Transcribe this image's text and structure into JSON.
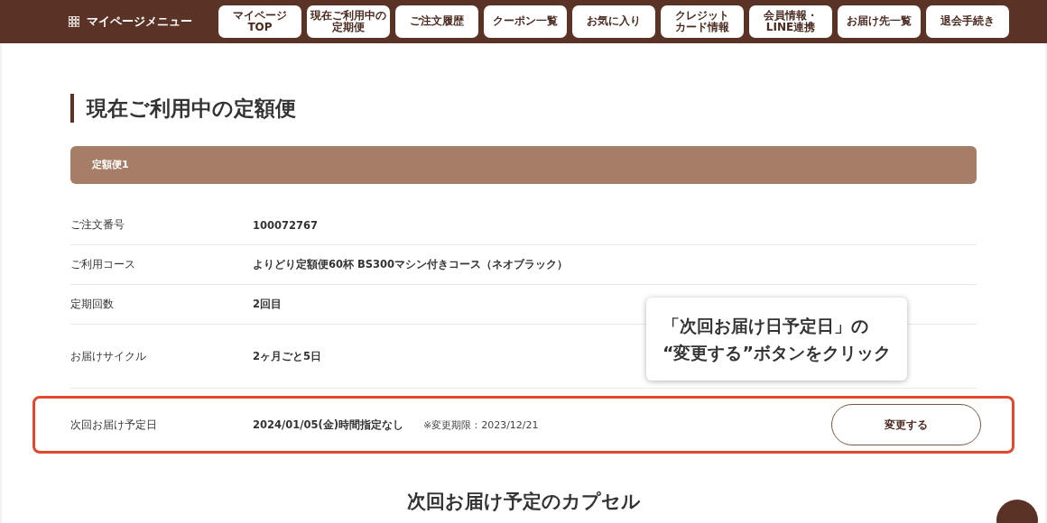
{
  "menu": {
    "title": "マイページメニュー",
    "items": [
      {
        "lines": [
          "マイページ",
          "TOP"
        ]
      },
      {
        "lines": [
          "現在ご利用中の",
          "定期便"
        ]
      },
      {
        "lines": [
          "ご注文履歴"
        ]
      },
      {
        "lines": [
          "クーポン一覧"
        ]
      },
      {
        "lines": [
          "お気に入り"
        ]
      },
      {
        "lines": [
          "クレジット",
          "カード情報"
        ]
      },
      {
        "lines": [
          "会員情報・",
          "LINE連携"
        ]
      },
      {
        "lines": [
          "お届け先一覧"
        ]
      },
      {
        "lines": [
          "退会手続き"
        ]
      }
    ]
  },
  "page_title": "現在ご利用中の定額便",
  "panel": {
    "title": "定額便1",
    "rows": [
      {
        "label": "ご注文番号",
        "value": "100072767",
        "highlighted": false
      },
      {
        "label": "ご利用コース",
        "value": "よりどり定額便60杯 BS300マシン付きコース（ネオブラック）",
        "highlighted": false
      },
      {
        "label": "定期回数",
        "value": "2回目",
        "highlighted": false
      },
      {
        "label": "お届けサイクル",
        "value": "2ヶ月ごと5日",
        "highlighted": false
      },
      {
        "label": "次回お届け予定日",
        "value": "2024/01/05(金)時間指定なし",
        "note": "※変更期限：2023/12/21",
        "button": "変更する",
        "highlighted": true
      }
    ]
  },
  "callout": {
    "lines": [
      "「次回お届け日予定日」の",
      "“変更する”ボタンをクリック"
    ]
  },
  "next_heading": "次回お届け予定のカプセル"
}
